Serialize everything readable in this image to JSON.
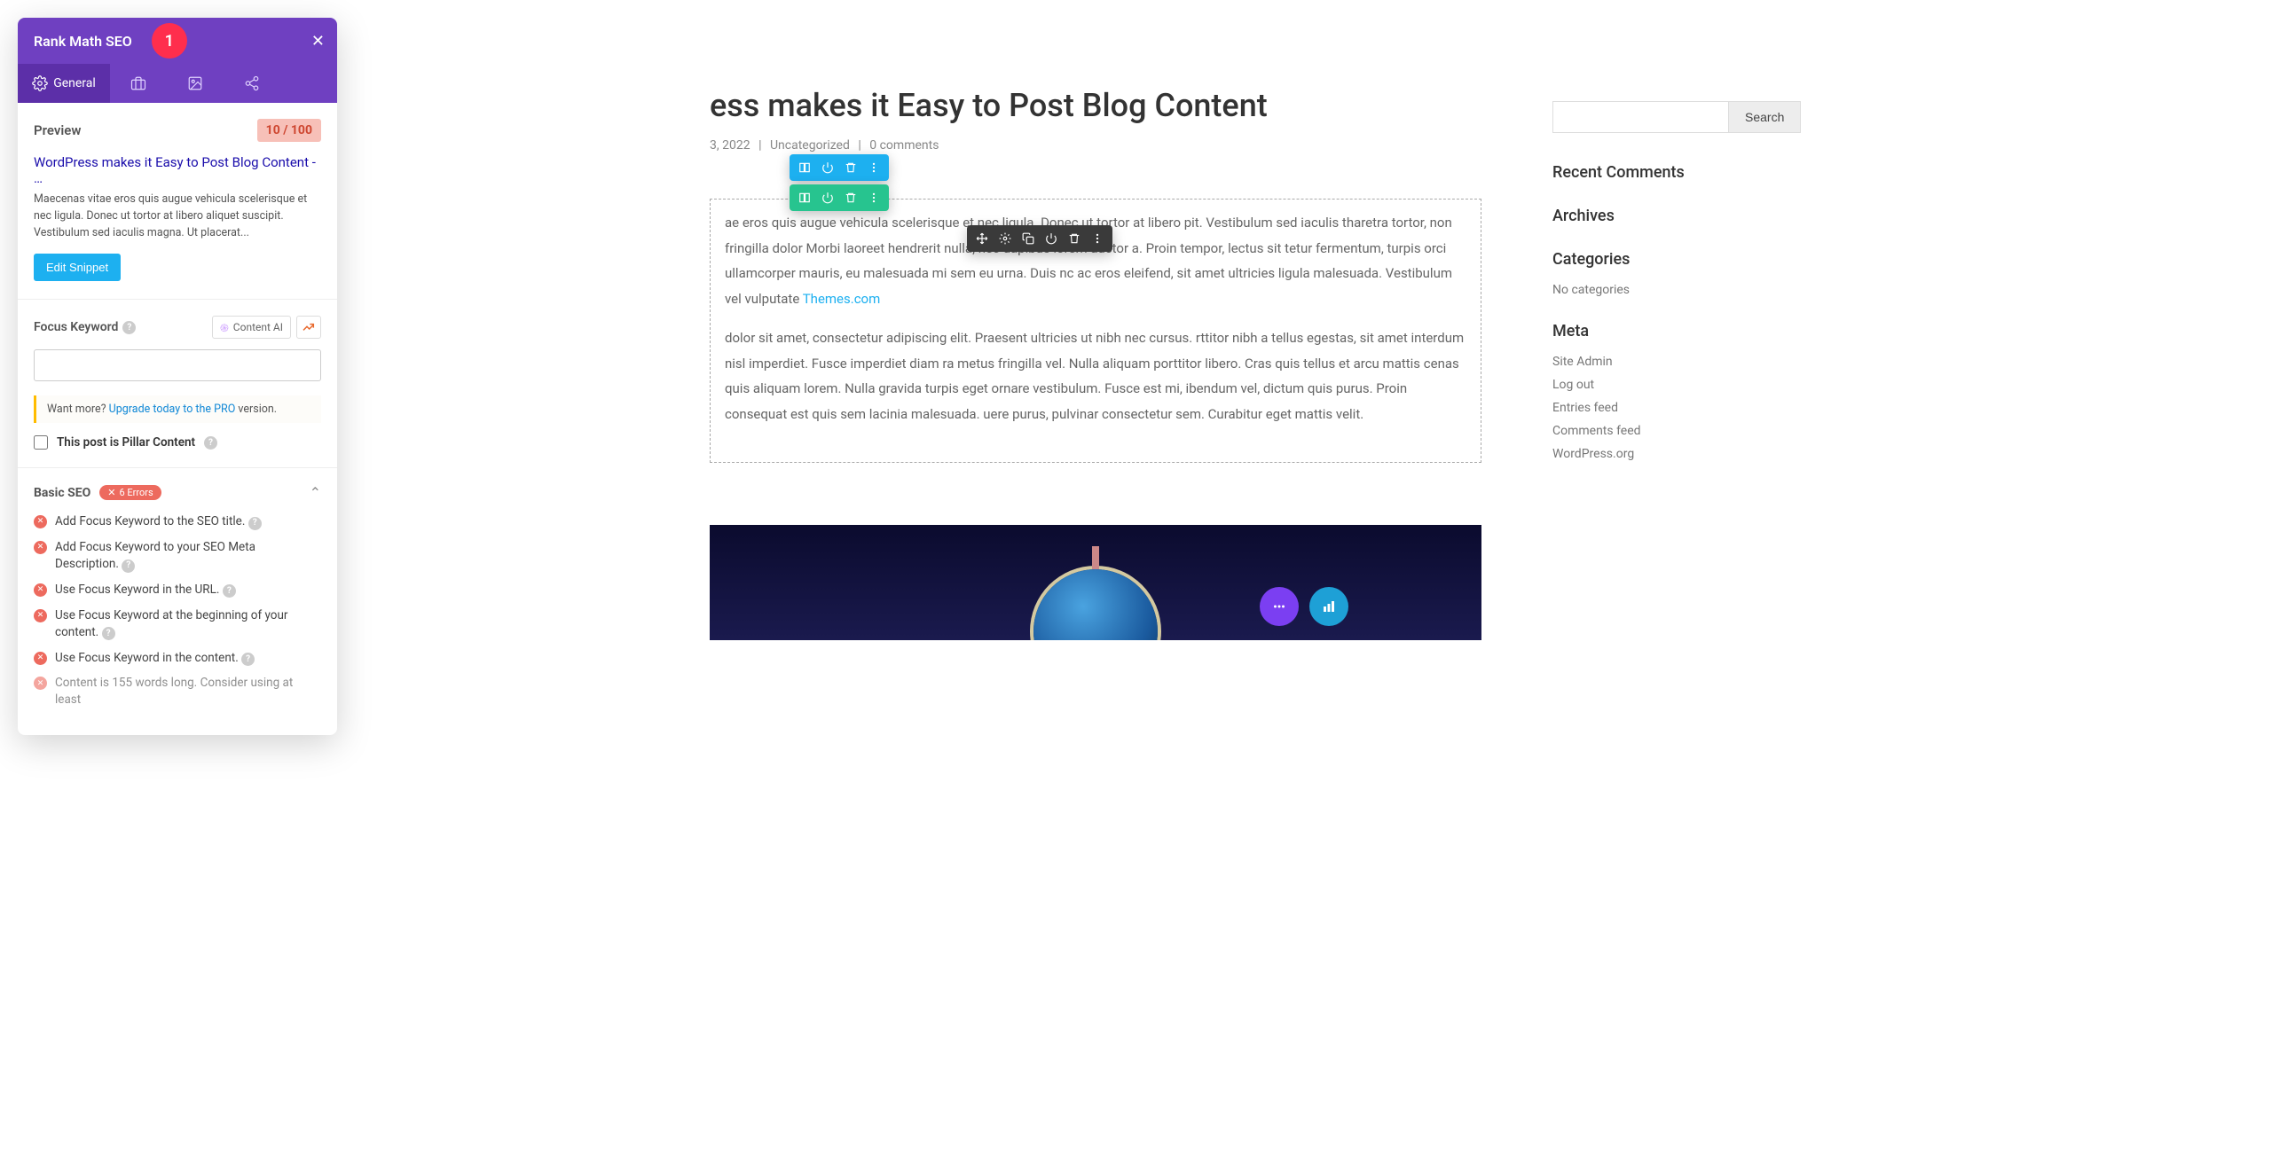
{
  "rankmath": {
    "title": "Rank Math SEO",
    "badge": "1",
    "tabs": {
      "general": "General"
    },
    "preview": {
      "label": "Preview",
      "score": "10 / 100",
      "title": "WordPress makes it Easy to Post Blog Content - …",
      "desc": "Maecenas vitae eros quis augue vehicula scelerisque et nec ligula. Donec ut tortor at libero aliquet suscipit. Vestibulum sed iaculis magna. Ut placerat...",
      "edit_btn": "Edit Snippet"
    },
    "focus_keyword": {
      "label": "Focus Keyword",
      "content_ai": "Content AI"
    },
    "upgrade": {
      "lead": "Want more?",
      "link": "Upgrade today to the PRO",
      "tail": " version."
    },
    "pillar_label": "This post is Pillar Content",
    "basic_seo": {
      "title": "Basic SEO",
      "errors_badge": "6 Errors",
      "items": [
        "Add Focus Keyword to the SEO title.",
        "Add Focus Keyword to your SEO Meta Description.",
        "Use Focus Keyword in the URL.",
        "Use Focus Keyword at the beginning of your content.",
        "Use Focus Keyword in the content.",
        "Content is 155 words long. Consider using at least"
      ]
    }
  },
  "post": {
    "title": "ess makes it Easy to Post Blog Content",
    "meta_date": "3, 2022",
    "meta_cat": "Uncategorized",
    "meta_comments": "0 comments",
    "para1_a": "ae eros quis augue vehicula scelerisque et nec ligula. Donec ut tortor at libero pit. Vestibulum sed iaculis tharetra tortor, non fringilla dolor Morbi laoreet hendrerit nulla, nec dapibus lorem auctor a. Proin tempor, lectus sit tetur fermentum, turpis orci ullamcorper mauris, eu malesuada mi sem eu urna. Duis nc ac eros eleifend, sit amet ultricies ligula malesuada. Vestibulum vel vulputate ",
    "para1_link": "Themes.com",
    "para2": "dolor sit amet, consectetur adipiscing elit. Praesent ultricies ut nibh nec cursus. rttitor nibh a tellus egestas, sit amet interdum nisl imperdiet. Fusce imperdiet diam ra metus fringilla vel. Nulla aliquam porttitor libero. Cras quis tellus et arcu mattis cenas quis aliquam lorem. Nulla gravida turpis eget ornare vestibulum. Fusce est mi, ibendum vel, dictum quis purus. Proin consequat est quis sem lacinia malesuada. uere purus, pulvinar consectetur sem. Curabitur eget mattis velit."
  },
  "sidebar": {
    "search_btn": "Search",
    "recent_comments": "Recent Comments",
    "archives": "Archives",
    "categories": "Categories",
    "no_categories": "No categories",
    "meta": "Meta",
    "meta_links": [
      "Site Admin",
      "Log out",
      "Entries feed",
      "Comments feed",
      "WordPress.org"
    ]
  }
}
